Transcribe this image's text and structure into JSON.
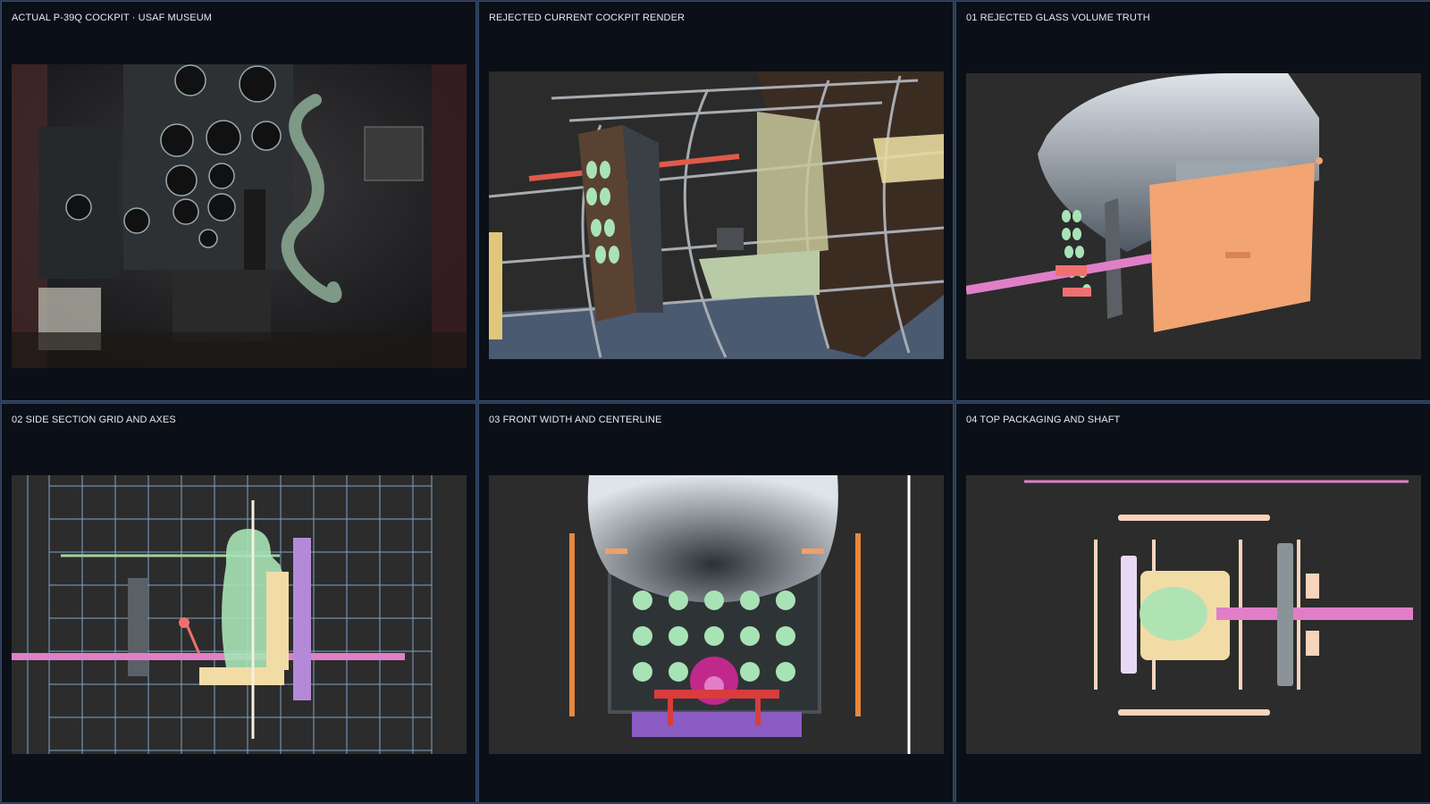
{
  "panels": [
    {
      "label": "ACTUAL P-39Q COCKPIT · USAF MUSEUM"
    },
    {
      "label": "REJECTED CURRENT COCKPIT RENDER"
    },
    {
      "label": "01 REJECTED GLASS VOLUME TRUTH"
    },
    {
      "label": "02 SIDE SECTION GRID AND AXES"
    },
    {
      "label": "03 FRONT WIDTH AND CENTERLINE"
    },
    {
      "label": "04 TOP PACKAGING AND SHAFT"
    }
  ],
  "colors": {
    "panel_bg": "#0b0f17",
    "panel_border": "#33496b",
    "viewport_bg": "#2c2c2c",
    "grid_line": "#7fa4c8",
    "accent_pink": "#e07fc8",
    "accent_orange": "#f0a06a",
    "accent_green": "#9fd49a",
    "accent_purple": "#b48ad8",
    "accent_cream": "#f2dca6"
  }
}
